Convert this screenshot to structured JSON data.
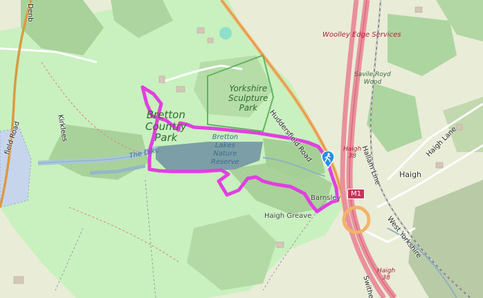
{
  "map": {
    "park_name": "Bretton\nCountry\nPark",
    "sculpture_park": "Yorkshire\nSculpture\nPark",
    "reserve": "Bretton\nLakes\nNature\nReserve",
    "huddersfield_road": "Huddersfield Road",
    "woolley_edge": "Woolley Edge Services",
    "savile_royd": "Savile Royd\nWood",
    "haigh": "Haigh",
    "haigh_lane": "Haigh Lane",
    "hallam_line": "Hallam Line",
    "west_yorkshire": "West Yorkshire",
    "haigh_greave": "Haigh Greave",
    "barnsley": "Barnsley",
    "kirklees": "Kirklees",
    "denby": "Denb",
    "field_road": "field Road",
    "the_dike": "The Dike",
    "haigh_38_top": "Haigh\n38",
    "haigh_38_bottom": "Haigh\n38",
    "m1": "M1",
    "swithen": "Swithen",
    "hiker_icon": "hiker-icon",
    "route_color": "#e040e0"
  }
}
